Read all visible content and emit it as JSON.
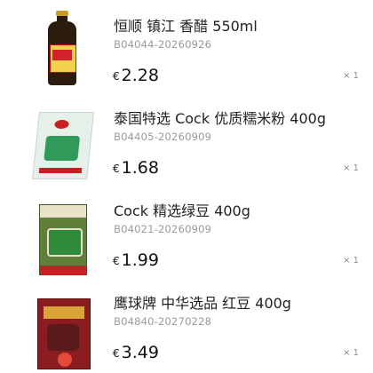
{
  "currency_symbol": "€",
  "items": [
    {
      "name": "恒顺 镇江 香醋 550ml",
      "sku": "B04044-20260926",
      "price": "2.28",
      "qty": "× 1",
      "thumb": "vinegar-bottle"
    },
    {
      "name": "泰国特选 Cock 优质糯米粉 400g",
      "sku": "B04405-20260909",
      "price": "1.68",
      "qty": "× 1",
      "thumb": "rice-flour-bag"
    },
    {
      "name": "Cock 精选绿豆 400g",
      "sku": "B04021-20260909",
      "price": "1.99",
      "qty": "× 1",
      "thumb": "mung-bean-bag"
    },
    {
      "name": "鹰球牌 中华选品 红豆 400g",
      "sku": "B04840-20270228",
      "price": "3.49",
      "qty": "× 1",
      "thumb": "red-bean-bag"
    }
  ]
}
